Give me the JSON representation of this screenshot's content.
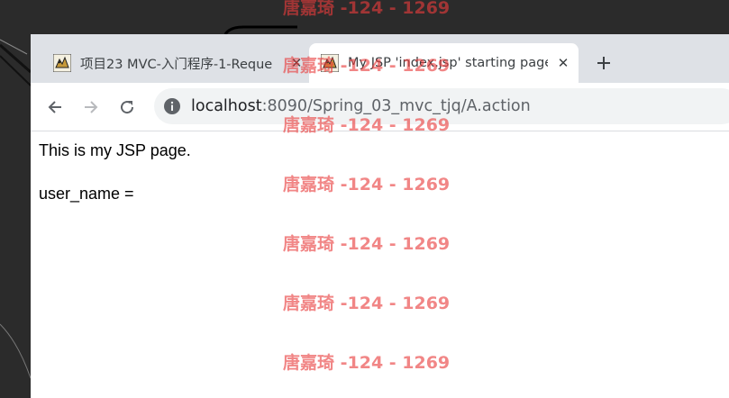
{
  "browser": {
    "tabs": [
      {
        "title": "项目23 MVC-入门程序-1-Reque",
        "active": false,
        "favicon": "tomcat-favicon"
      },
      {
        "title": "My JSP 'index.jsp' starting page",
        "active": true,
        "favicon": "tomcat-favicon"
      }
    ],
    "new_tab_icon": "plus-icon",
    "close_icon": "close-icon"
  },
  "toolbar": {
    "back_icon": "back-arrow-icon",
    "forward_icon": "forward-arrow-icon",
    "reload_icon": "reload-icon",
    "site_info_icon": "info-icon",
    "url_host": "localhost",
    "url_rest": ":8090/Spring_03_mvc_tjq/A.action"
  },
  "page": {
    "line1": "This is my JSP page.",
    "line2": "user_name ="
  },
  "watermark": {
    "text": "唐嘉琦 -124 - 1269",
    "color": "#e83c3c"
  },
  "colors": {
    "tabstrip": "#dee1e6",
    "omnibox": "#f1f3f4",
    "desktop": "#2b2b2b"
  }
}
